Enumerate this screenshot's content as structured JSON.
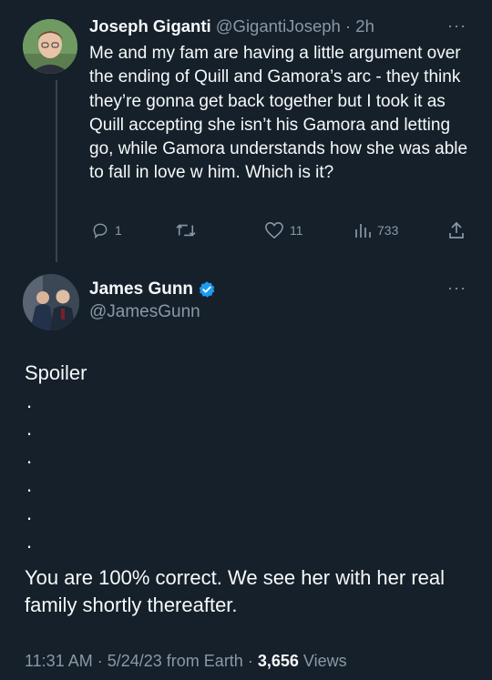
{
  "parent_tweet": {
    "author_name": "Joseph Giganti",
    "handle": "@GigantiJoseph",
    "separator": " · ",
    "time": "2h",
    "more": "···",
    "text": "Me and my fam are having a little argument over the ending of Quill and Gamora’s arc - they think they’re gonna get back together but I took it as Quill accepting she isn’t his Gamora and letting go, while Gamora understands how she was able to fall in love w him. Which is it?",
    "replies": "1",
    "likes": "11",
    "views": "733"
  },
  "main_tweet": {
    "author_name": "James Gunn",
    "handle": "@JamesGunn",
    "verified": true,
    "more": "···",
    "spoiler_line": "Spoiler",
    "dots": [
      ".",
      ".",
      ".",
      ".",
      ".",
      "."
    ],
    "body": "You are 100% correct. We see her with her real family shortly thereafter.",
    "time": "11:31 AM",
    "date": "5/24/23",
    "source": "from Earth",
    "views_count": "3,656",
    "views_label": "Views",
    "sep": " · "
  },
  "colors": {
    "background": "#15202b",
    "text": "#f7f9f9",
    "secondary": "#8b98a5",
    "verified": "#1d9bf0"
  }
}
